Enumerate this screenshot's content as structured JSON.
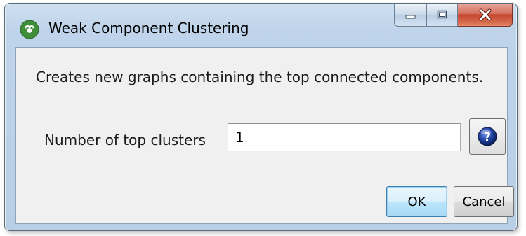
{
  "window": {
    "title": "Weak Component Clustering",
    "app_icon": "cytoscape-logo-icon",
    "caption_buttons": [
      "minimize-icon",
      "maximize-icon",
      "close-icon"
    ]
  },
  "dialog": {
    "description": "Creates new graphs containing the top connected components.",
    "field_label": "Number of top clusters",
    "field_value": "1",
    "help_icon": "help-question-icon"
  },
  "buttons": {
    "ok_label": "OK",
    "cancel_label": "Cancel"
  },
  "colors": {
    "titlebar": "#bfd4ea",
    "client_background": "#f0f0f0",
    "close_button": "#c6472e",
    "default_button_border": "#3c7fb1",
    "help_icon": "#1d3f9a"
  }
}
